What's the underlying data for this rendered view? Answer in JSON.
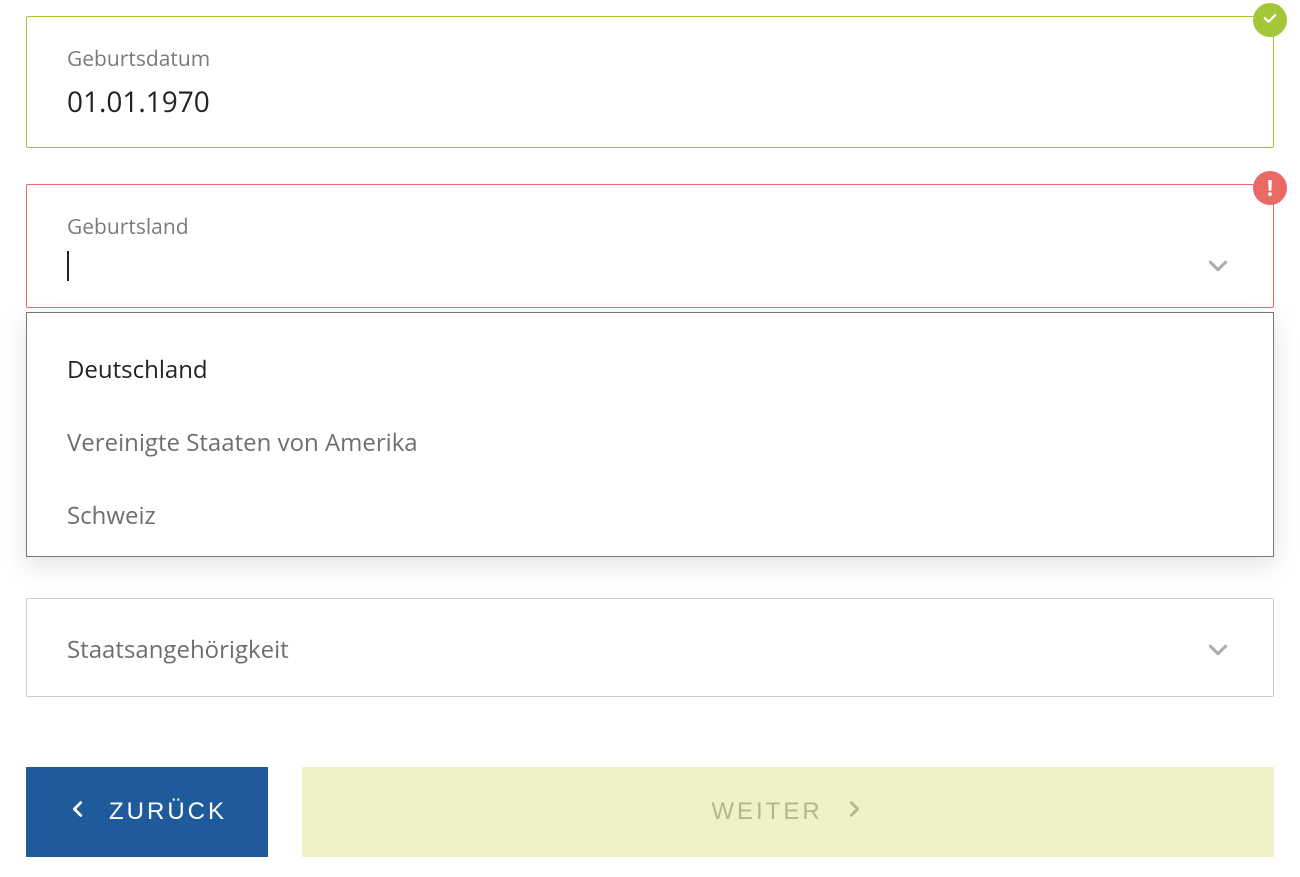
{
  "birthdate": {
    "label": "Geburtsdatum",
    "value": "01.01.1970",
    "state": "valid"
  },
  "birthcountry": {
    "label": "Geburtsland",
    "value": "",
    "state": "error",
    "options": [
      "Deutschland",
      "Vereinigte Staaten von Amerika",
      "Schweiz"
    ],
    "highlight_index": 0
  },
  "nationality": {
    "label": "Staatsangehörigkeit"
  },
  "buttons": {
    "back": "ZURÜCK",
    "next": "WEITER"
  }
}
